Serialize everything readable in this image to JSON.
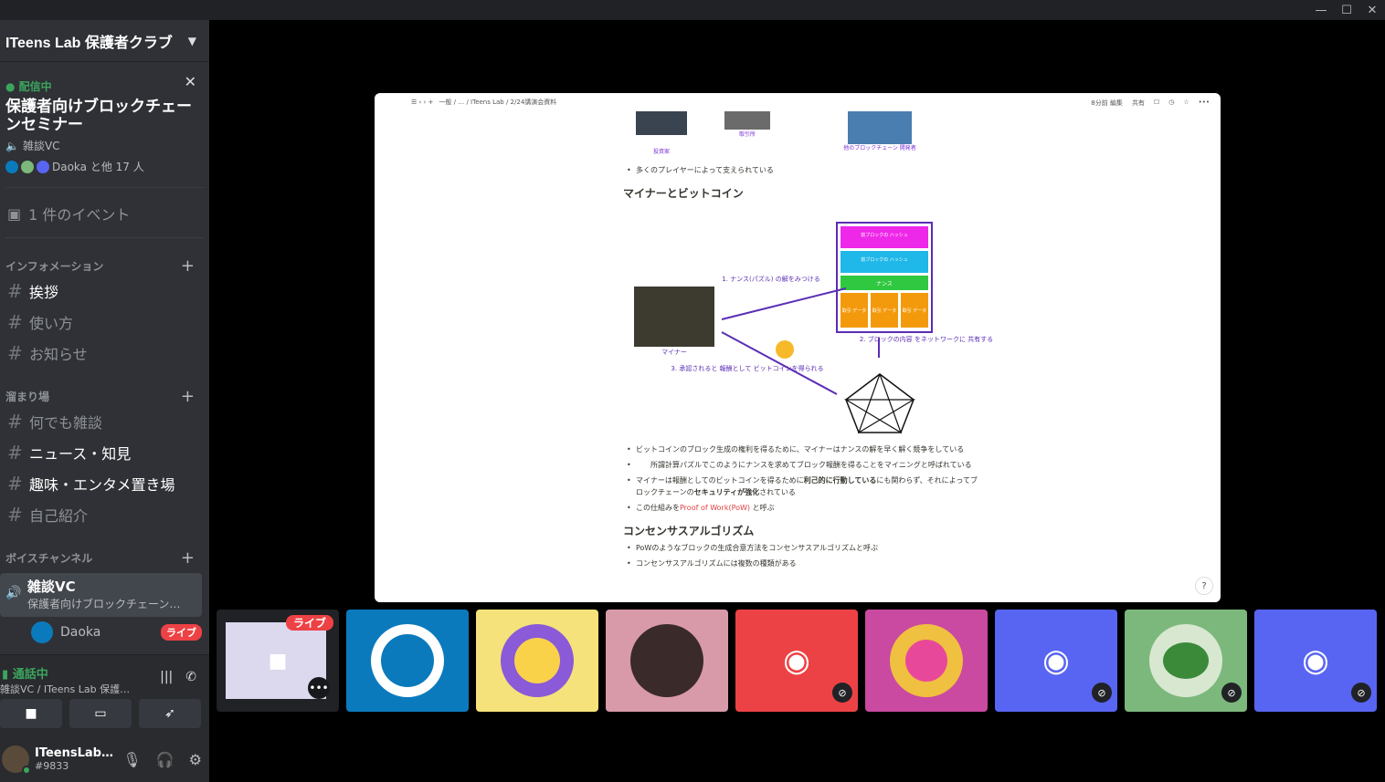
{
  "window": {
    "minimize": "—",
    "maximize": "☐",
    "close": "✕"
  },
  "server": {
    "name": "ITeens Lab 保護者クラブ"
  },
  "stage": {
    "status": "● 配信中",
    "title": "保護者向けブロックチェーンセミナー",
    "channel": "雑談VC",
    "participants": "Daoka と他 17 人"
  },
  "events": {
    "label": "1 件のイベント"
  },
  "categories": [
    {
      "name": "インフォメーション",
      "channels": [
        "挨拶",
        "使い方",
        "お知らせ"
      ]
    },
    {
      "name": "溜まり場",
      "channels": [
        "何でも雑談",
        "ニュース・知見",
        "趣味・エンタメ置き場",
        "自己紹介"
      ]
    },
    {
      "name": "ボイスチャンネル"
    }
  ],
  "voice_channel": {
    "name": "雑談VC",
    "topic": "保護者向けブロックチェーン…",
    "user": "Daoka",
    "live": "ライブ"
  },
  "rtc": {
    "status": "通話中",
    "location": "雑談VC / ITeens Lab 保護…"
  },
  "user": {
    "name": "ITeensLab…",
    "tag": "#9833"
  },
  "doc": {
    "breadcrumb": "一般 / … / ITeens Lab / 2/24講演会資料",
    "edited": "8分前 編集",
    "share": "共有",
    "labels": {
      "investor": "投資家",
      "exchange": "取引所",
      "dev": "他のブロックチェーン 開発者"
    },
    "b1": "多くのプレイヤーによって支えられている",
    "h1": "マイナーとビットコイン",
    "diagram": {
      "prev_hash": "前ブロックの ハッシュ",
      "prev_hash2": "前ブロックの ハッシュ",
      "nonce": "ナンス",
      "tx": "取引 データ",
      "miner": "マイナー",
      "step1": "1. ナンス(パズル) の解をみつける",
      "step2": "2. ブロックの内容 をネットワークに 共有する",
      "step3": "3. 承認されると 報酬として ビットコインを得られる"
    },
    "b2": "ビットコインのブロック生成の権利を得るために、マイナーはナンスの解を早く解く競争をしている",
    "b2sub": "所謂計算パズルでこのようにナンスを求めてブロック報酬を得ることをマイニングと呼ばれている",
    "b3a": "マイナーは報酬としてのビットコインを得るために",
    "b3b": "利己的に行動している",
    "b3c": "にも関わらず、それによってブロックチェーンの",
    "b3d": "セキュリティが強化",
    "b3e": "されている",
    "b4a": "この仕組みを",
    "b4b": "Proof of Work(PoW)",
    "b4c": " と呼ぶ",
    "h2": "コンセンサスアルゴリズム",
    "b5": "PoWのようなブロックの生成合意方法をコンセンサスアルゴリズムと呼ぶ",
    "b6": "コンセンサスアルゴリズムには複数の種類がある",
    "help": "?"
  },
  "tiles": {
    "live": "ライブ",
    "more": "•••",
    "colors": [
      "#0b7abd",
      "#f5e27a",
      "#d89aa8",
      "#ed4245",
      "#c94aa0",
      "#5865f2",
      "#7cb87c",
      "#5865f2"
    ]
  }
}
